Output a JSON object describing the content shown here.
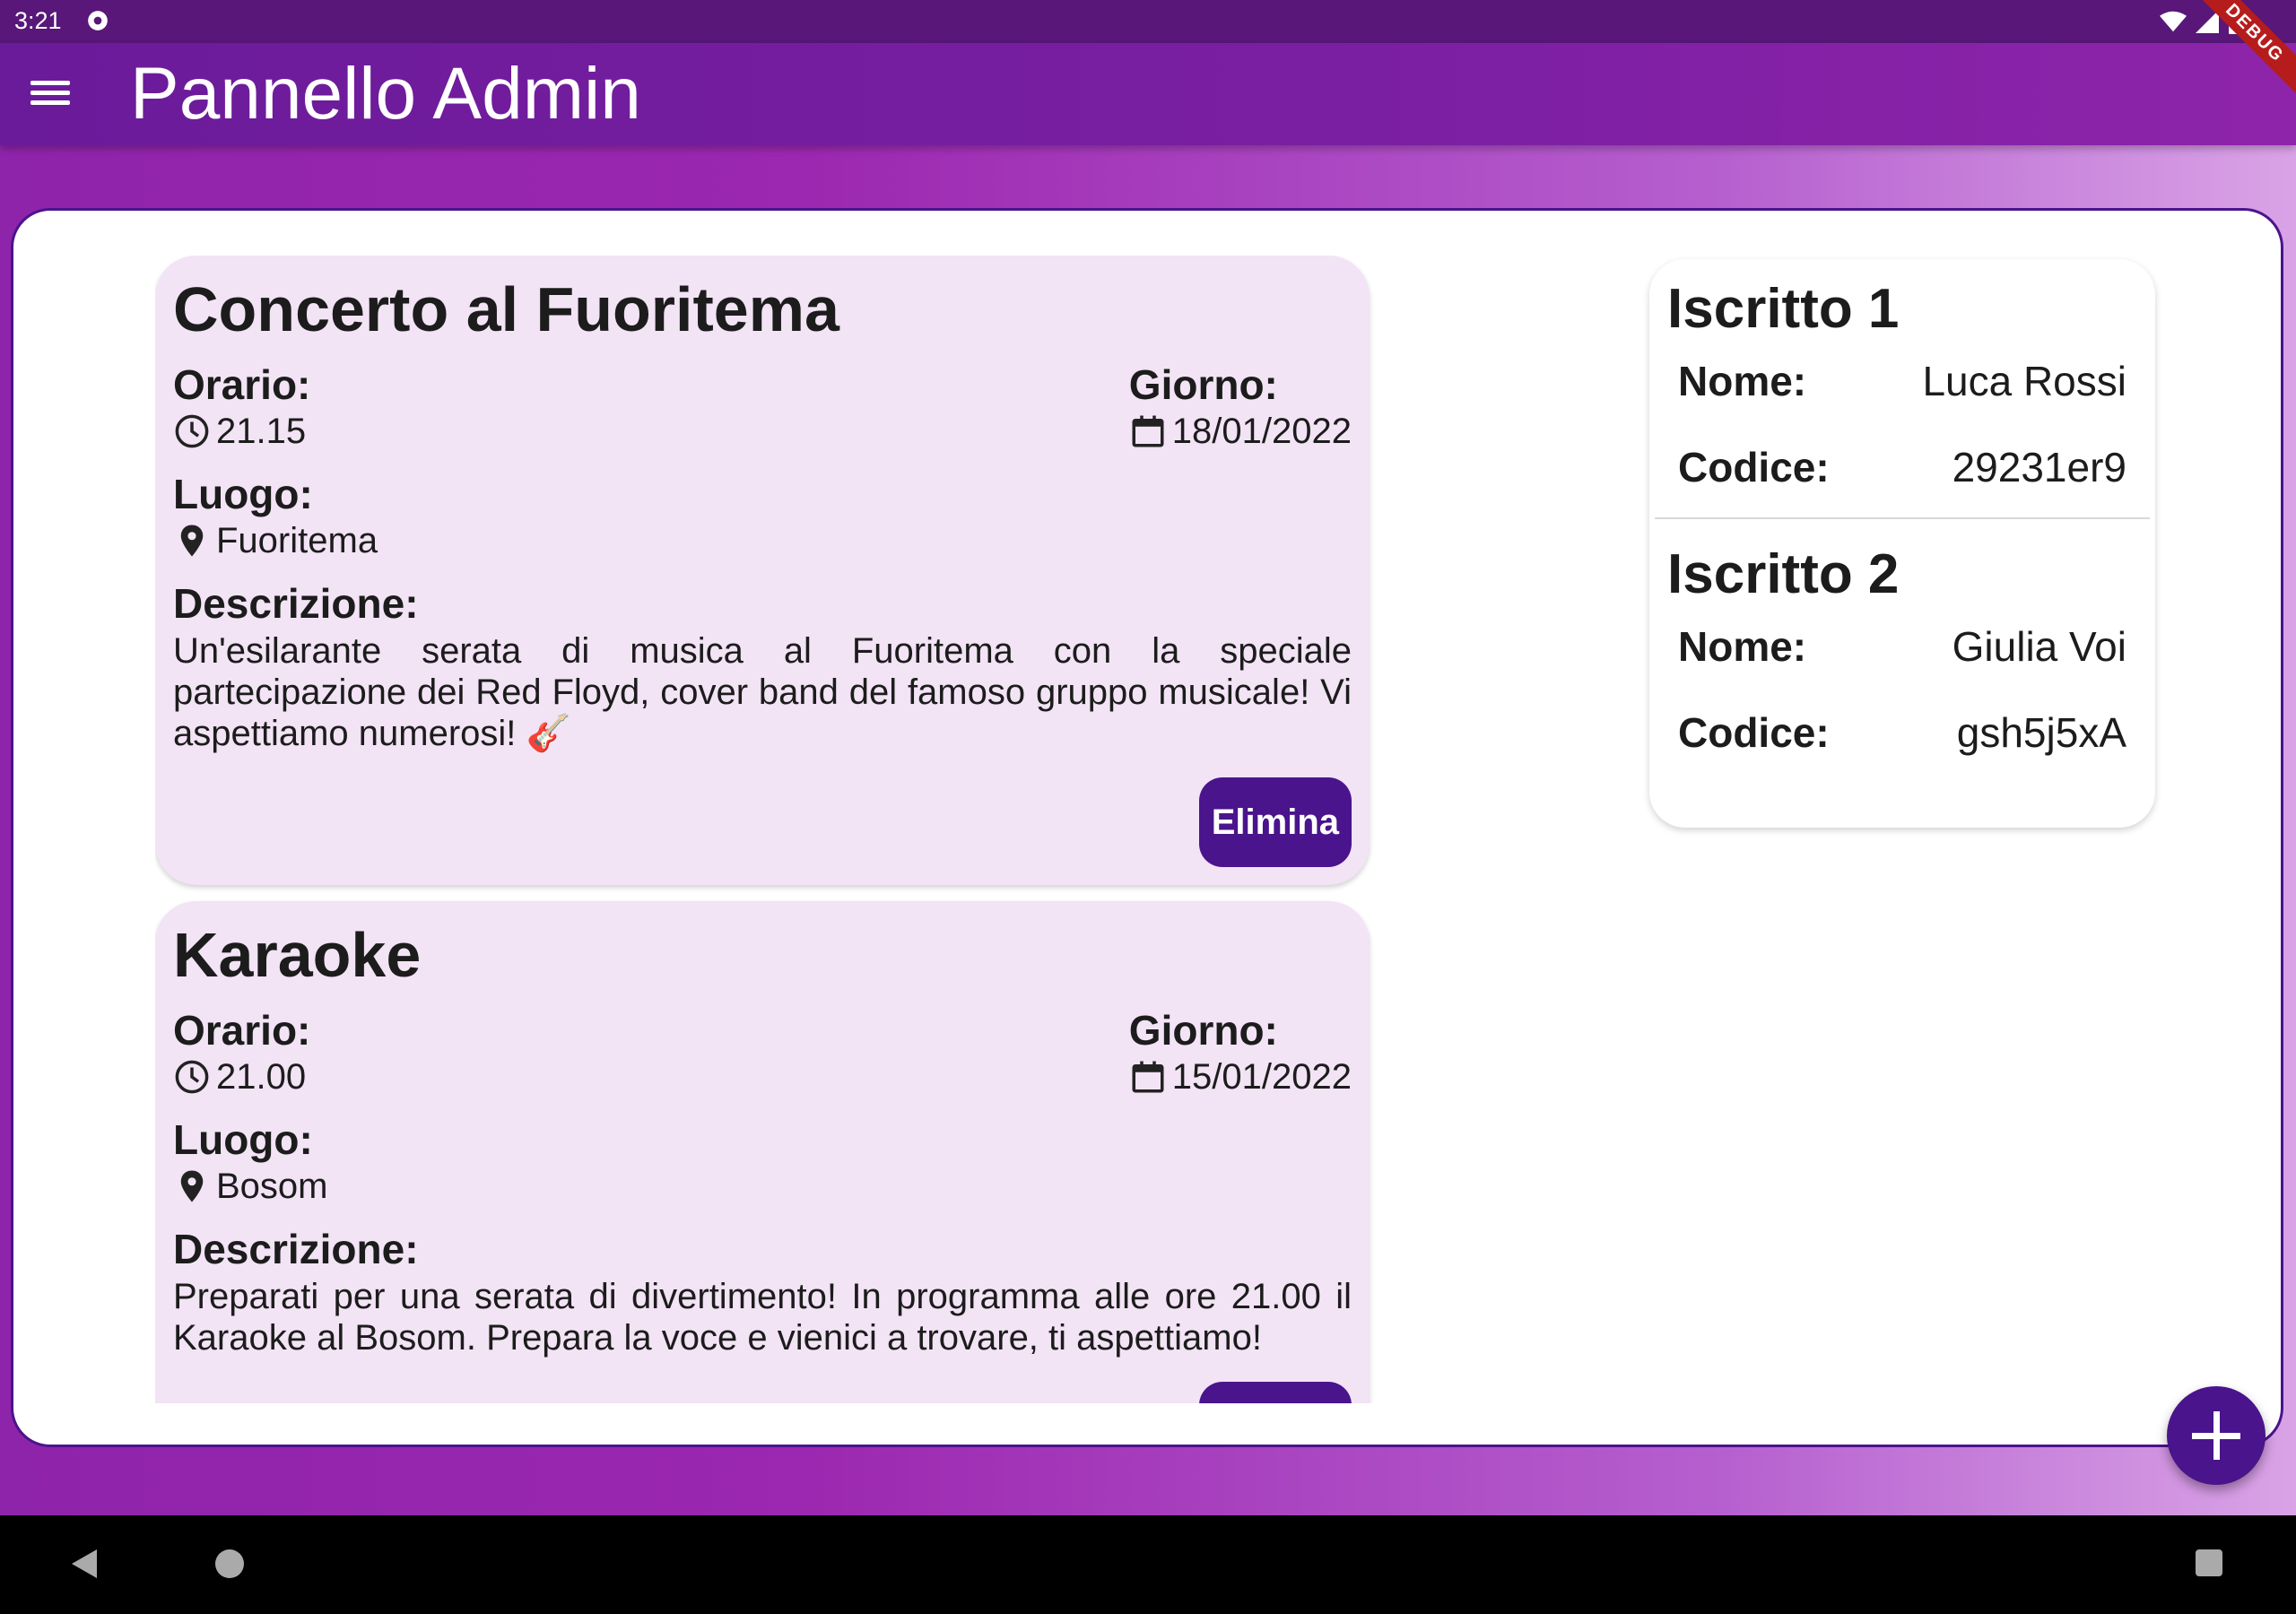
{
  "status": {
    "time": "3:21",
    "debug": "DEBUG"
  },
  "appbar": {
    "title": "Pannello Admin"
  },
  "labels": {
    "orario": "Orario:",
    "giorno": "Giorno:",
    "luogo": "Luogo:",
    "descrizione": "Descrizione:",
    "elimina": "Elimina",
    "nome": "Nome:",
    "codice": "Codice:"
  },
  "events": [
    {
      "title": "Concerto al Fuoritema",
      "time": "21.15",
      "date": "18/01/2022",
      "place": "Fuoritema",
      "description": "Un'esilarante serata di musica al Fuoritema con la speciale partecipazione dei Red Floyd, cover band del famoso gruppo musicale! Vi aspettiamo numerosi! 🎸"
    },
    {
      "title": "Karaoke",
      "time": "21.00",
      "date": "15/01/2022",
      "place": "Bosom",
      "description": "Preparati per una serata di divertimento! In programma alle ore 21.00 il Karaoke al Bosom. Prepara la voce e vienici a trovare, ti aspettiamo!"
    }
  ],
  "subscribers": [
    {
      "title": "Iscritto 1",
      "name": "Luca Rossi",
      "code": "29231er9"
    },
    {
      "title": "Iscritto 2",
      "name": "Giulia Voi",
      "code": "gsh5j5xA"
    }
  ],
  "icons": {
    "menu": "menu-icon",
    "clock": "clock-icon",
    "calendar": "calendar-icon",
    "pin": "location-pin-icon",
    "add": "add-icon"
  },
  "colors": {
    "appbar": "#7b1fa2",
    "card": "#f2e3f5",
    "button": "#4a148c"
  }
}
